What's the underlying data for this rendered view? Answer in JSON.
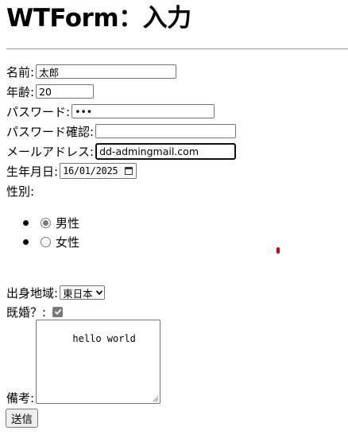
{
  "page_title": "WTForm：入力",
  "form": {
    "name": {
      "label": "名前:",
      "value": "太郎"
    },
    "age": {
      "label": "年齢:",
      "value": "20"
    },
    "password": {
      "label": "パスワード:",
      "value": "•••"
    },
    "password_confirm": {
      "label": "パスワード確認:",
      "value": ""
    },
    "email": {
      "label": "メールアドレス:",
      "value": "dd-admingmail.com"
    },
    "birthdate": {
      "label": "生年月日:",
      "value": "16/01/2025",
      "icon": "calendar-icon"
    },
    "gender": {
      "label": "性別:",
      "options": [
        {
          "label": "男性",
          "checked": true
        },
        {
          "label": "女性",
          "checked": false
        }
      ]
    },
    "region": {
      "label": "出身地域:",
      "value": "東日本",
      "icon": "chevron-down-icon"
    },
    "married": {
      "label": "既婚？:",
      "checked": true,
      "icon": "checkmark-icon"
    },
    "notes": {
      "label": "備考:",
      "value": "hello world"
    },
    "submit": {
      "label": "送信"
    }
  },
  "colors": {
    "accent_checked": "#7a7a7a",
    "focus_border": "#101010",
    "red_mark": "#d40000"
  }
}
